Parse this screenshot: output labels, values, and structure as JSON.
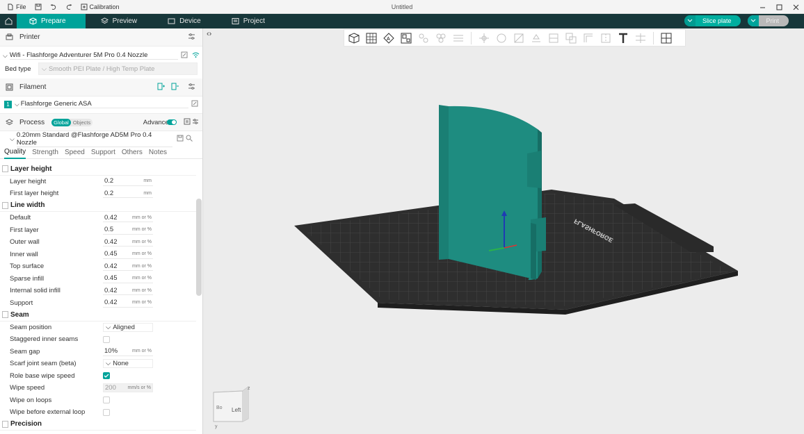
{
  "titlebar": {
    "file_label": "File",
    "calibration_label": "Calibration",
    "window_title": "Untitled"
  },
  "tabs": [
    {
      "label": "Prepare"
    },
    {
      "label": "Preview"
    },
    {
      "label": "Device"
    },
    {
      "label": "Project"
    }
  ],
  "actions": {
    "slice_label": "Slice plate",
    "print_label": "Print"
  },
  "printer": {
    "section_label": "Printer",
    "name": "Wifi - Flashforge Adventurer 5M Pro 0.4 Nozzle",
    "bed_type_label": "Bed type",
    "bed_type_value": "Smooth PEI Plate / High Temp Plate"
  },
  "filament": {
    "section_label": "Filament",
    "slot": "1",
    "name": "Flashforge Generic ASA"
  },
  "process": {
    "section_label": "Process",
    "global_label": "Global",
    "objects_label": "Objects",
    "advanced_label": "Advanced",
    "preset": "0.20mm Standard @Flashforge AD5M Pro 0.4 Nozzle",
    "subtabs": [
      "Quality",
      "Strength",
      "Speed",
      "Support",
      "Others",
      "Notes"
    ]
  },
  "groups": {
    "layer_height": "Layer height",
    "line_width": "Line width",
    "seam": "Seam",
    "precision": "Precision"
  },
  "params": {
    "layer_height": {
      "label": "Layer height",
      "value": "0.2",
      "unit": "mm"
    },
    "first_layer_height": {
      "label": "First layer height",
      "value": "0.2",
      "unit": "mm"
    },
    "lw_default": {
      "label": "Default",
      "value": "0.42",
      "unit": "mm or %"
    },
    "lw_first_layer": {
      "label": "First layer",
      "value": "0.5",
      "unit": "mm or %"
    },
    "lw_outer_wall": {
      "label": "Outer wall",
      "value": "0.42",
      "unit": "mm or %"
    },
    "lw_inner_wall": {
      "label": "Inner wall",
      "value": "0.45",
      "unit": "mm or %"
    },
    "lw_top_surface": {
      "label": "Top surface",
      "value": "0.42",
      "unit": "mm or %"
    },
    "lw_sparse_infill": {
      "label": "Sparse infill",
      "value": "0.45",
      "unit": "mm or %"
    },
    "lw_internal_solid": {
      "label": "Internal solid infill",
      "value": "0.42",
      "unit": "mm or %"
    },
    "lw_support": {
      "label": "Support",
      "value": "0.42",
      "unit": "mm or %"
    },
    "seam_position": {
      "label": "Seam position",
      "value": "Aligned"
    },
    "staggered": {
      "label": "Staggered inner seams"
    },
    "seam_gap": {
      "label": "Seam gap",
      "value": "10%",
      "unit": "mm or %"
    },
    "scarf": {
      "label": "Scarf joint seam (beta)",
      "value": "None"
    },
    "role_base": {
      "label": "Role base wipe speed"
    },
    "wipe_speed": {
      "label": "Wipe speed",
      "value": "200",
      "unit": "mm/s or %"
    },
    "wipe_loops": {
      "label": "Wipe on loops"
    },
    "wipe_before": {
      "label": "Wipe before external loop"
    }
  },
  "viewcube": {
    "face_label": "Left",
    "side_label": "Bo",
    "axis_z": "z",
    "axis_y": "y"
  },
  "bed_brand": "FLASHFORGE",
  "colors": {
    "accent": "#00a39a",
    "tabbar": "#17373a",
    "model": "#1e8c80",
    "bed": "#2e2e2e"
  }
}
